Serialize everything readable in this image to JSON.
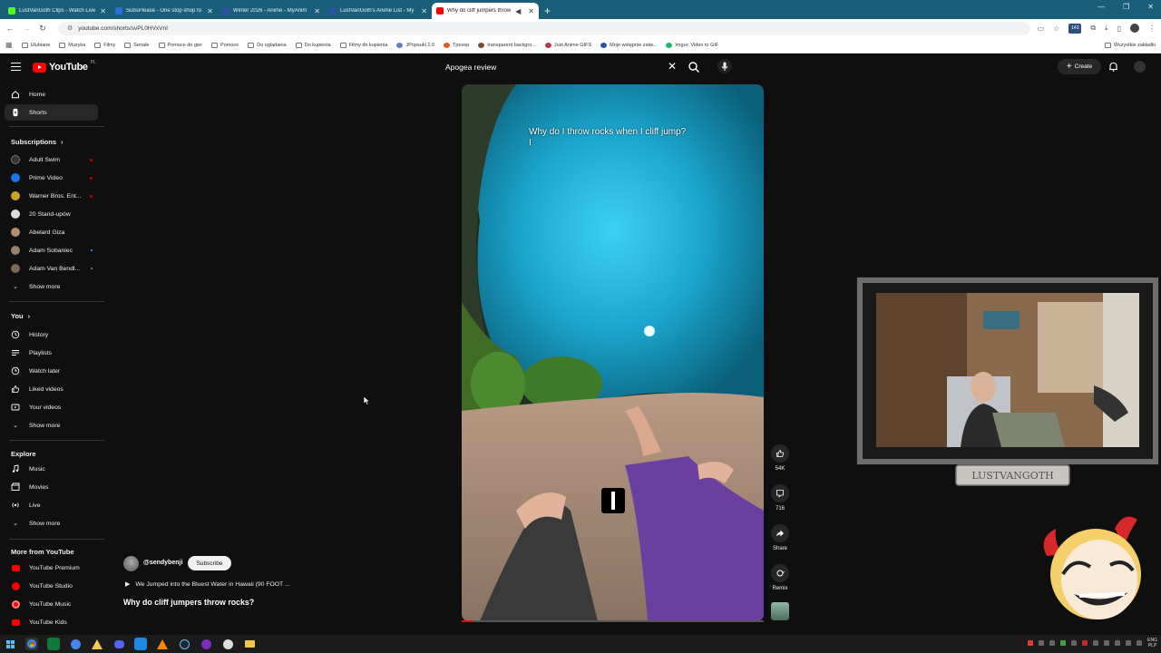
{
  "browser": {
    "tabs": [
      {
        "title": "LustVanGoth Clips - Watch Live",
        "favicon_color": "#53fc18"
      },
      {
        "title": "SubsPlease - One stop shop fo",
        "favicon_color": "#2d6cdf"
      },
      {
        "title": "Winter 2026 - Anime - MyAnim",
        "favicon_color": "#2e51a2"
      },
      {
        "title": "LustVanGoth's Anime List - My",
        "favicon_color": "#2e51a2"
      },
      {
        "title": "Why do cliff jumpers throw",
        "favicon_color": "#ff0000"
      }
    ],
    "url": "youtube.com/shorts/svPL0HVxVnI",
    "bookmarks": [
      "Ulubiane",
      "Muzyka",
      "Filmy",
      "Seriale",
      "Pomoce do gier",
      "Pomoce",
      "Do oglądania",
      "Do kupienia",
      "Filmy do kupienia",
      "JPopsuki 2.0",
      "Tpexep",
      "transparent backgro...",
      "Just Anime GIFS",
      "Moje wstępnie zatw...",
      "Imgur: Video to GIF"
    ],
    "all_bookmarks": "Wszystkie zakładki"
  },
  "header": {
    "logo": "YouTube",
    "country": "PL",
    "search_query": "Apogea review",
    "create_label": "Create"
  },
  "sidebar": {
    "main": [
      {
        "label": "Home",
        "icon": "home-icon"
      },
      {
        "label": "Shorts",
        "icon": "shorts-icon",
        "active": true
      }
    ],
    "subscriptions_title": "Subscriptions",
    "subscriptions": [
      {
        "label": "Adult Swim",
        "color": "#333333",
        "live": true
      },
      {
        "label": "Prime Video",
        "color": "#1a73e8",
        "live": true
      },
      {
        "label": "Warner Bros. Ent...",
        "color": "#c9a227",
        "live": true
      },
      {
        "label": "20 Stand-upów",
        "color": "#dddddd",
        "live": false
      },
      {
        "label": "Abelard Giza",
        "color": "#b38b6d",
        "live": false
      },
      {
        "label": "Adam Sobaniec",
        "color": "#9a7f6b",
        "live": false
      },
      {
        "label": "Adam Van Bendl...",
        "color": "#7a6a55",
        "live": false
      }
    ],
    "show_more": "Show more",
    "you_title": "You",
    "you_items": [
      {
        "label": "History",
        "icon": "history-icon"
      },
      {
        "label": "Playlists",
        "icon": "playlists-icon"
      },
      {
        "label": "Watch later",
        "icon": "watch-later-icon"
      },
      {
        "label": "Liked videos",
        "icon": "liked-videos-icon"
      },
      {
        "label": "Your videos",
        "icon": "your-videos-icon"
      }
    ],
    "explore_title": "Explore",
    "explore_items": [
      {
        "label": "Music",
        "icon": "music-icon"
      },
      {
        "label": "Movies",
        "icon": "movies-icon"
      },
      {
        "label": "Live",
        "icon": "live-icon"
      }
    ],
    "more_title": "More from YouTube",
    "more_items": [
      "YouTube Premium",
      "YouTube Studio",
      "YouTube Music",
      "YouTube Kids"
    ]
  },
  "short": {
    "overlay_text": "Why do I throw rocks when I cliff jump?",
    "overlay_line2": "I",
    "channel": "@sendybenji",
    "subscribe_label": "Subscribe",
    "related_video": "We Jumped into the Bluest Water in Hawaii (90 FOOT ...",
    "title": "Why do cliff jumpers throw rocks?",
    "progress_fraction": 0.04
  },
  "actions": {
    "likes": "54K",
    "comments": "716",
    "share": "Share",
    "remix": "Remix"
  },
  "overlay": {
    "streamer_name": "LUSTVANGOTH"
  },
  "taskbar": {
    "lang": "ENG",
    "region": "PLP"
  }
}
